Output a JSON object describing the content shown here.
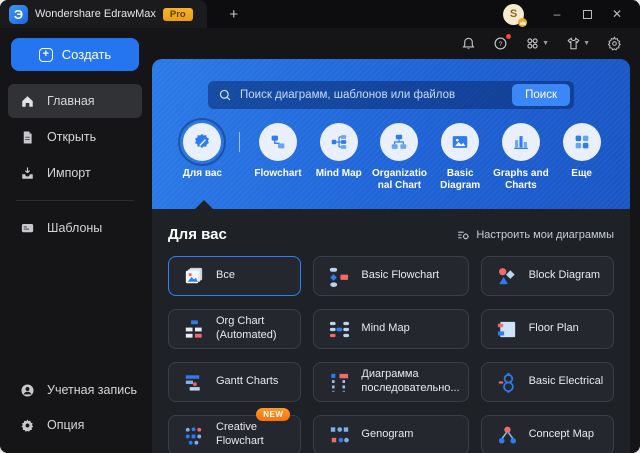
{
  "titlebar": {
    "app_title": "Wondershare EdrawMax",
    "pro_badge": "Pro",
    "new_tab": "+",
    "avatar_letter": "S"
  },
  "toolbar": {
    "icons": [
      "bell-icon",
      "help-icon",
      "workspace-icon",
      "theme-icon",
      "settings-icon"
    ]
  },
  "sidebar": {
    "create_button": "Создать",
    "items": [
      {
        "label": "Главная",
        "icon": "home-icon",
        "active": true
      },
      {
        "label": "Открыть",
        "icon": "open-file-icon",
        "active": false
      },
      {
        "label": "Импорт",
        "icon": "import-icon",
        "active": false
      },
      {
        "label": "Шаблоны",
        "icon": "templates-icon",
        "active": false
      }
    ],
    "footer_items": [
      {
        "label": "Учетная запись",
        "icon": "account-icon"
      },
      {
        "label": "Опция",
        "icon": "gear-icon"
      }
    ]
  },
  "hero": {
    "search_placeholder": "Поиск диаграмм, шаблонов или файлов",
    "search_button": "Поиск",
    "categories": [
      {
        "label": "Для вас",
        "icon": "for-you-icon",
        "selected": true
      },
      {
        "label": "Flowchart",
        "icon": "flowchart-icon",
        "selected": false
      },
      {
        "label": "Mind Map",
        "icon": "mindmap-icon",
        "selected": false
      },
      {
        "label": "Organizational Chart",
        "icon": "orgchart-icon",
        "selected": false
      },
      {
        "label": "Basic Diagram",
        "icon": "basic-diagram-icon",
        "selected": false
      },
      {
        "label": "Graphs and Charts",
        "icon": "bar-chart-icon",
        "selected": false
      },
      {
        "label": "Еще",
        "icon": "more-grid-icon",
        "selected": false
      }
    ]
  },
  "content": {
    "section_title": "Для вас",
    "customize_link": "Настроить мои диаграммы",
    "cards": [
      {
        "label": "Все",
        "icon": "all-templates-icon",
        "selected": true
      },
      {
        "label": "Basic Flowchart",
        "icon": "basic-flowchart-icon",
        "selected": false
      },
      {
        "label": "Block Diagram",
        "icon": "block-diagram-icon",
        "selected": false
      },
      {
        "label": "Org Chart (Automated)",
        "icon": "org-chart-icon",
        "selected": false
      },
      {
        "label": "Mind Map",
        "icon": "mind-map-icon",
        "selected": false
      },
      {
        "label": "Floor Plan",
        "icon": "floor-plan-icon",
        "selected": false
      },
      {
        "label": "Gantt Charts",
        "icon": "gantt-icon",
        "selected": false
      },
      {
        "label": "Диаграмма последовательно...",
        "icon": "sequence-diagram-icon",
        "selected": false
      },
      {
        "label": "Basic Electrical",
        "icon": "electrical-icon",
        "selected": false
      },
      {
        "label": "Creative Flowchart",
        "icon": "creative-flowchart-icon",
        "badge": "NEW",
        "selected": false
      },
      {
        "label": "Genogram",
        "icon": "genogram-icon",
        "selected": false
      },
      {
        "label": "Concept Map",
        "icon": "concept-map-icon",
        "selected": false
      }
    ]
  },
  "colors": {
    "accent_blue": "#2f7bf0",
    "hero_gradient_start": "#2b7ae8",
    "hero_gradient_end": "#1a56c4",
    "pro_badge_bg": "#f0a818",
    "new_badge_bg": "#ff7d1f",
    "icon_red": "#ef6a6a",
    "icon_light_blue": "#aecdf2",
    "card_bg": "#24282e",
    "content_bg": "#1e2126"
  }
}
